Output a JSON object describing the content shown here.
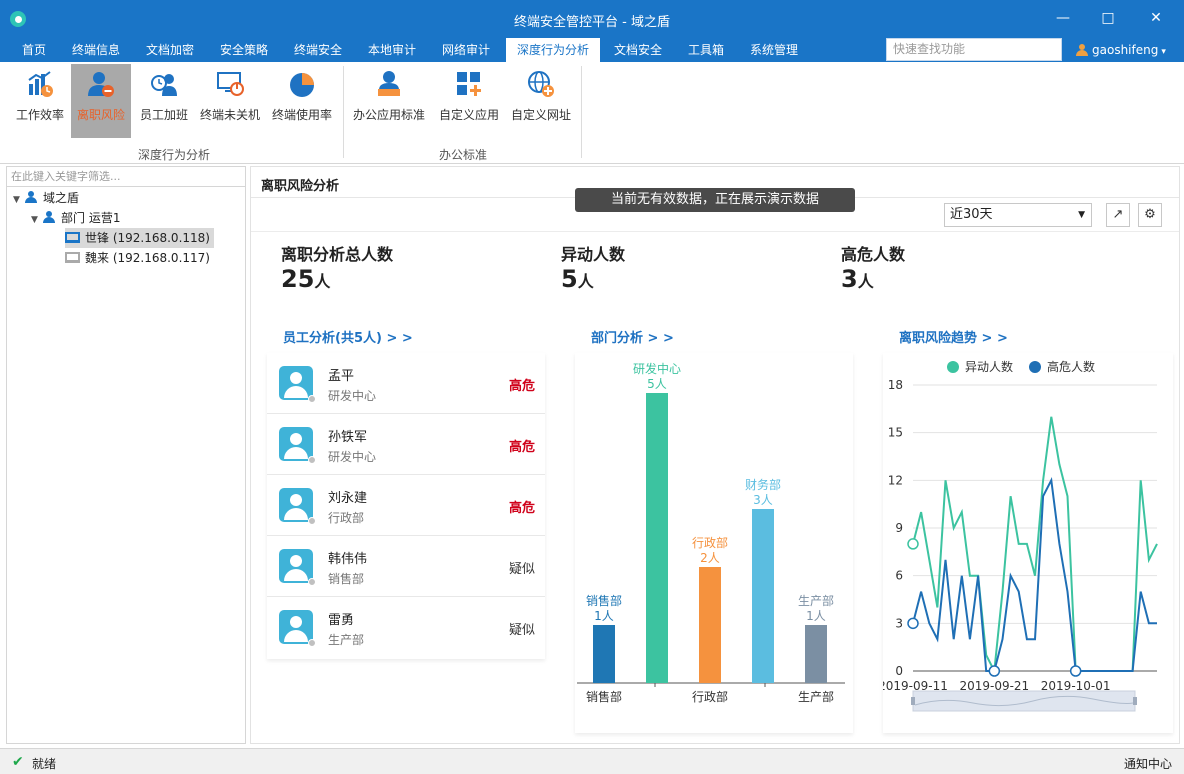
{
  "window": {
    "title": "终端安全管控平台 - 域之盾",
    "controls": [
      "minimize-icon",
      "maximize-icon",
      "close-icon"
    ]
  },
  "menu": {
    "items": [
      "首页",
      "终端信息",
      "文档加密",
      "安全策略",
      "终端安全",
      "本地审计",
      "网络审计",
      "深度行为分析",
      "文档安全",
      "工具箱",
      "系统管理"
    ],
    "active": "深度行为分析",
    "quick_search_placeholder": "快速查找功能",
    "user": "gaoshifeng"
  },
  "ribbon": {
    "groups": [
      {
        "label": "深度行为分析",
        "buttons": [
          "工作效率",
          "离职风险",
          "员工加班",
          "终端未关机",
          "终端使用率"
        ]
      },
      {
        "label": "办公标准",
        "buttons": [
          "办公应用标准",
          "自定义应用",
          "自定义网址"
        ]
      }
    ],
    "active_button": "离职风险"
  },
  "tree": {
    "search_placeholder": "在此键入关键字筛选...",
    "root": "域之盾",
    "department": "部门 运营1",
    "terminals": [
      {
        "label": "世锋 (192.168.0.118)",
        "online": true,
        "selected": true
      },
      {
        "label": "魏来 (192.168.0.117)",
        "online": false,
        "selected": false
      }
    ]
  },
  "content": {
    "title": "离职风险分析",
    "toast": "当前无有效数据，正在展示演示数据",
    "range": "近30天",
    "stats": [
      {
        "label": "离职分析总人数",
        "value": "25",
        "unit": "人"
      },
      {
        "label": "异动人数",
        "value": "5",
        "unit": "人"
      },
      {
        "label": "高危人数",
        "value": "3",
        "unit": "人"
      }
    ],
    "sections": {
      "employee": "员工分析(共5人) > >",
      "department": "部门分析 > >",
      "trend": "离职风险趋势 > >"
    },
    "employees": [
      {
        "name": "孟平",
        "dept": "研发中心",
        "risk": "高危",
        "level": "high"
      },
      {
        "name": "孙铁军",
        "dept": "研发中心",
        "risk": "高危",
        "level": "high"
      },
      {
        "name": "刘永建",
        "dept": "行政部",
        "risk": "高危",
        "level": "high"
      },
      {
        "name": "韩伟伟",
        "dept": "销售部",
        "risk": "疑似",
        "level": "susp"
      },
      {
        "name": "雷勇",
        "dept": "生产部",
        "risk": "疑似",
        "level": "susp"
      }
    ]
  },
  "chart_data": [
    {
      "type": "bar",
      "categories": [
        "销售部",
        "研发中心",
        "行政部",
        "财务部",
        "生产部"
      ],
      "values": [
        1,
        5,
        2,
        3,
        1
      ],
      "value_labels": [
        "1人",
        "5人",
        "2人",
        "3人",
        "1人"
      ],
      "colors": [
        "#1f77b4",
        "#3cc3a0",
        "#f5923e",
        "#5bbde0",
        "#7b8fa3"
      ],
      "x_tick_labels": [
        "销售部",
        "行政部",
        "生产部"
      ]
    },
    {
      "type": "line",
      "legend": [
        "异动人数",
        "高危人数"
      ],
      "legend_position": "top",
      "ylim": [
        0,
        18
      ],
      "yticks": [
        0,
        3,
        6,
        9,
        12,
        15,
        18
      ],
      "x_tick_labels": [
        "2019-09-11",
        "2019-09-21",
        "2019-10-01"
      ],
      "series": [
        {
          "name": "异动人数",
          "color": "#3cc3a0",
          "values": [
            8,
            10,
            7,
            4,
            12,
            9,
            10,
            6,
            6,
            1,
            0,
            5,
            11,
            8,
            8,
            6,
            12,
            16,
            13,
            11,
            0,
            0,
            0,
            0,
            0,
            0,
            0,
            0,
            12,
            7,
            8
          ]
        },
        {
          "name": "高危人数",
          "color": "#1f6fb5",
          "values": [
            3,
            5,
            3,
            2,
            7,
            2,
            6,
            2,
            6,
            0,
            0,
            2,
            6,
            5,
            2,
            2,
            11,
            12,
            8,
            5,
            0,
            0,
            0,
            0,
            0,
            0,
            0,
            0,
            5,
            3,
            3
          ]
        }
      ]
    }
  ],
  "status": {
    "text": "就绪",
    "right": "通知中心"
  }
}
